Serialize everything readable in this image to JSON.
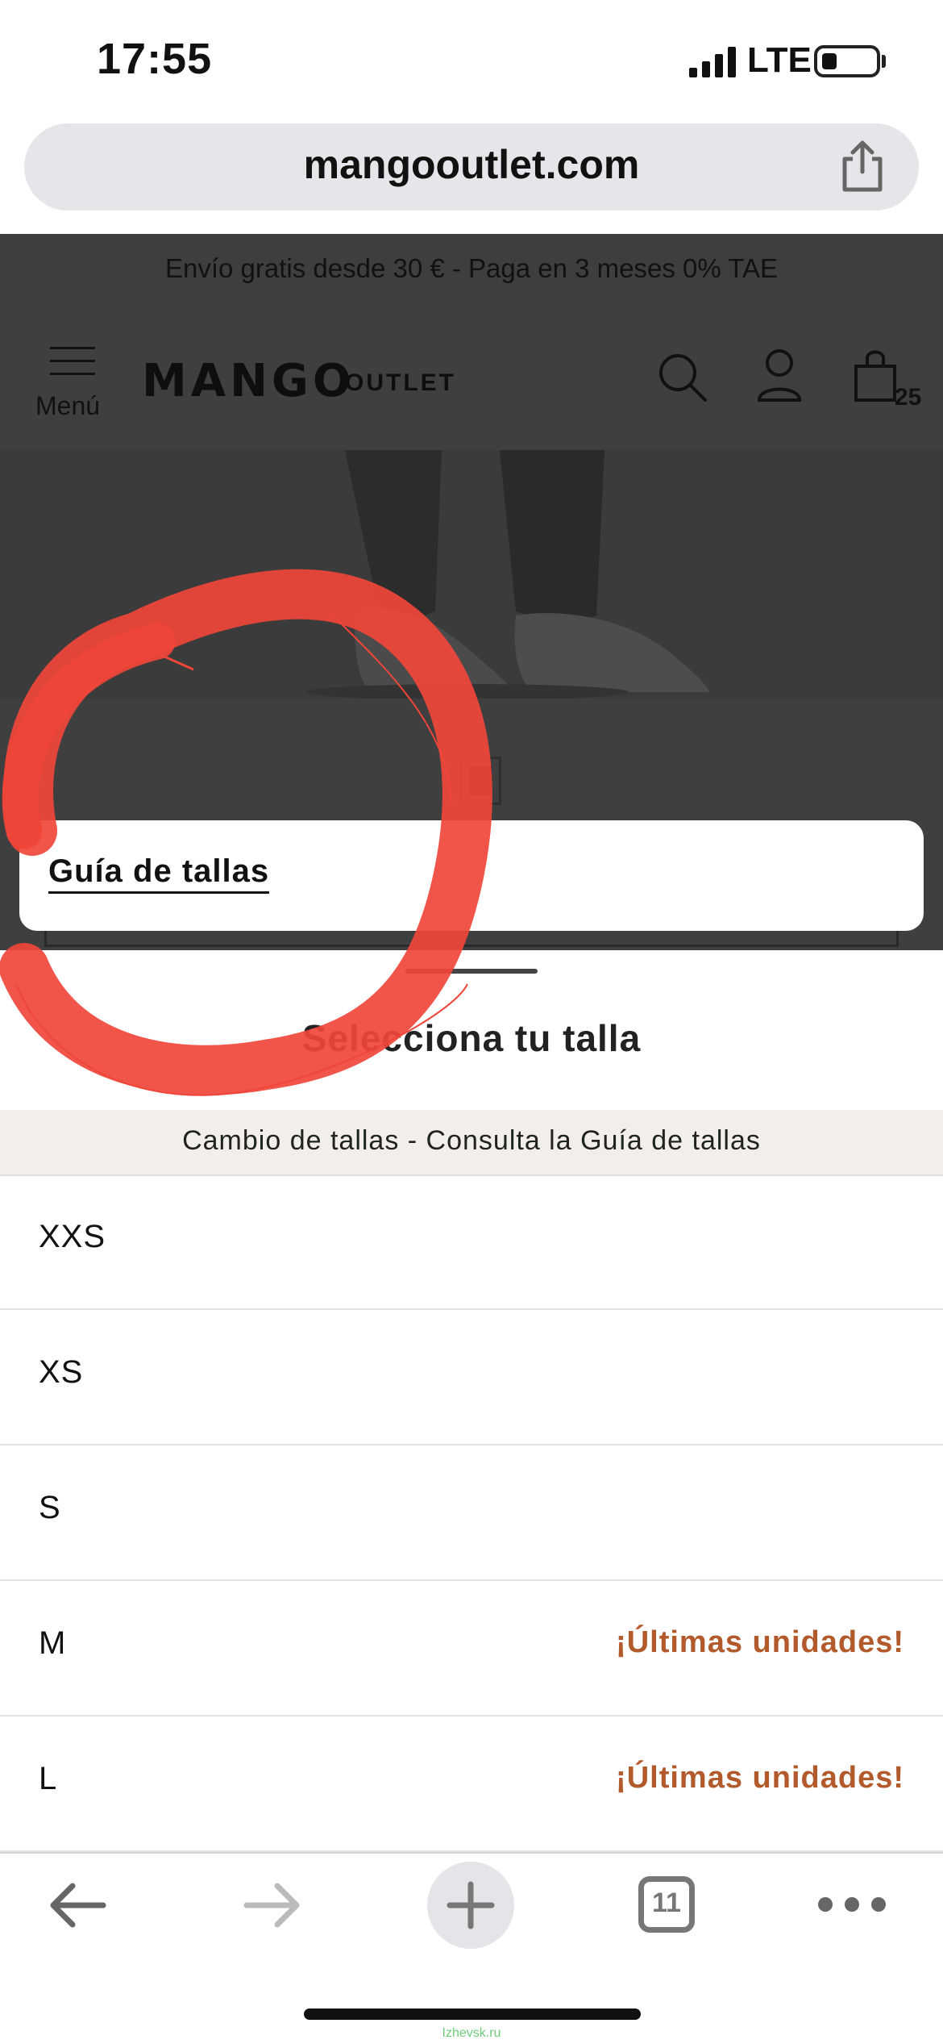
{
  "status_bar": {
    "time": "17:55",
    "network": "LTE",
    "icons": [
      "signal-icon",
      "battery-icon"
    ]
  },
  "browser": {
    "url": "mangooutlet.com",
    "share_icon": "share-icon",
    "tabs_count": "11"
  },
  "promo_banner": {
    "text": "Envío gratis desde 30 € - Paga en 3 meses 0% TAE"
  },
  "header": {
    "menu_label": "Menú",
    "logo_text": "MANGO",
    "logo_sub": "OUTLET",
    "cart_count": "25",
    "icons": [
      "hamburger-icon",
      "search-icon",
      "user-icon",
      "bag-icon"
    ]
  },
  "size_guide_card": {
    "label": "Guía de tallas"
  },
  "size_sheet": {
    "title": "Selecciona tu talla",
    "notice": "Cambio de tallas - Consulta la Guía de tallas",
    "sizes": [
      {
        "label": "XXS",
        "status": ""
      },
      {
        "label": "XS",
        "status": ""
      },
      {
        "label": "S",
        "status": ""
      },
      {
        "label": "M",
        "status": "¡Últimas unidades!"
      },
      {
        "label": "L",
        "status": "¡Últimas unidades!"
      }
    ]
  },
  "toolbar": {
    "icons": [
      "back-arrow-icon",
      "forward-arrow-icon",
      "plus-icon",
      "tabs-icon",
      "more-icon"
    ]
  },
  "watermark": "Izhevsk.ru",
  "colors": {
    "accent_warning": "#b25a2b",
    "annotation": "#f0453a",
    "notice_bg": "#f2eee9"
  }
}
